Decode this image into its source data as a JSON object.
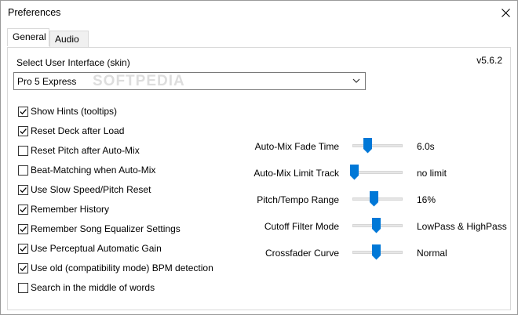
{
  "window": {
    "title": "Preferences"
  },
  "tabs": [
    {
      "label": "General",
      "active": true
    },
    {
      "label": "Audio",
      "active": false
    }
  ],
  "version": "v5.6.2",
  "skin": {
    "label": "Select User Interface (skin)",
    "value": "Pro 5 Express",
    "watermark": "SOFTPEDIA"
  },
  "checkboxes": [
    {
      "label": "Show Hints (tooltips)",
      "checked": true
    },
    {
      "label": "Reset Deck after Load",
      "checked": true
    },
    {
      "label": "Reset Pitch after Auto-Mix",
      "checked": false
    },
    {
      "label": "Beat-Matching when Auto-Mix",
      "checked": false
    },
    {
      "label": "Use Slow Speed/Pitch Reset",
      "checked": true
    },
    {
      "label": "Remember History",
      "checked": true
    },
    {
      "label": "Remember Song Equalizer Settings",
      "checked": true
    },
    {
      "label": "Use Perceptual Automatic Gain",
      "checked": true
    },
    {
      "label": "Use old (compatibility mode) BPM detection",
      "checked": true
    },
    {
      "label": "Search in the middle of words",
      "checked": false
    }
  ],
  "sliders": [
    {
      "label": "Auto-Mix Fade Time",
      "value": "6.0s",
      "level": 0.3
    },
    {
      "label": "Auto-Mix Limit Track",
      "value": "no limit",
      "level": 0.0
    },
    {
      "label": "Pitch/Tempo Range",
      "value": "16%",
      "level": 0.45
    },
    {
      "label": "Cutoff Filter Mode",
      "value": "LowPass & HighPass",
      "level": 0.5
    },
    {
      "label": "Crossfader Curve",
      "value": "Normal",
      "level": 0.5
    }
  ],
  "colors": {
    "accent": "#0078d7",
    "border": "#d9d9d9"
  }
}
